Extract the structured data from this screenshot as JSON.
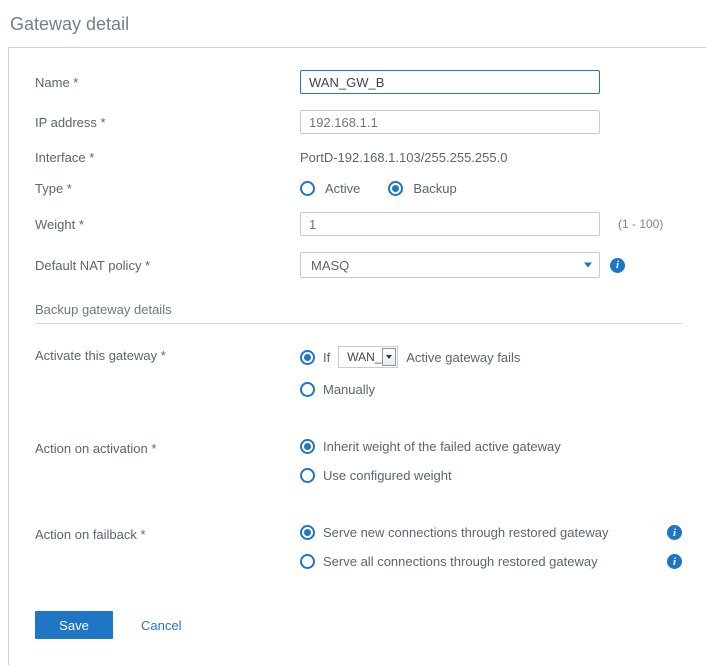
{
  "pageTitle": "Gateway detail",
  "fields": {
    "name": {
      "label": "Name *",
      "value": "WAN_GW_B"
    },
    "ip": {
      "label": "IP address *",
      "placeholder": "192.168.1.1"
    },
    "interface": {
      "label": "Interface *",
      "value": "PortD-192.168.1.103/255.255.255.0"
    },
    "type": {
      "label": "Type *",
      "options": {
        "active": "Active",
        "backup": "Backup"
      },
      "selected": "backup"
    },
    "weight": {
      "label": "Weight *",
      "placeholder": "1",
      "hint": "(1 - 100)"
    },
    "nat": {
      "label": "Default NAT policy *",
      "value": "MASQ"
    }
  },
  "backupSection": {
    "header": "Backup gateway details",
    "activate": {
      "label": "Activate this gateway *",
      "ifPrefix": "If",
      "gatewaySelected": "WAN_G",
      "ifSuffix": "Active gateway fails",
      "manual": "Manually",
      "selected": "if"
    },
    "onActivation": {
      "label": "Action on activation *",
      "inherit": "Inherit weight of the failed active gateway",
      "configured": "Use configured weight",
      "selected": "inherit"
    },
    "onFailback": {
      "label": "Action on failback *",
      "new": "Serve new connections through restored gateway",
      "all": "Serve all connections through restored gateway",
      "selected": "new"
    }
  },
  "buttons": {
    "save": "Save",
    "cancel": "Cancel"
  }
}
